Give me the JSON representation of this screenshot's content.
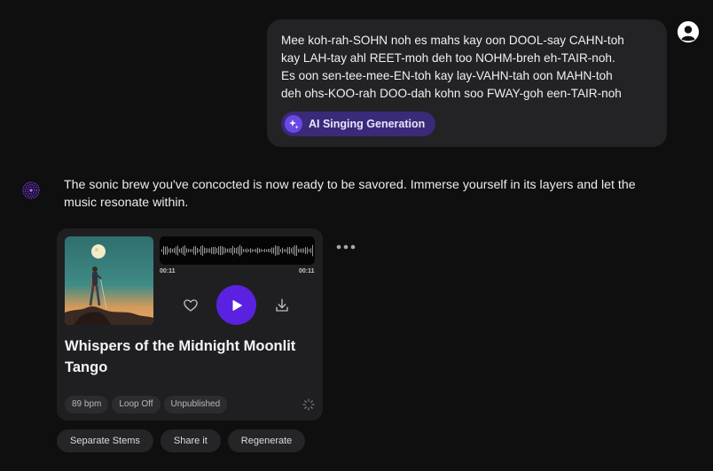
{
  "user_message": {
    "text": "Mee koh-rah-SOHN noh es mahs kay oon DOOL-say CAHN-toh\nkay LAH-tay ahl REET-moh deh too NOHM-breh eh-TAIR-noh.\nEs oon sen-tee-mee-EN-toh kay lay-VAHN-tah oon MAHN-toh\ndeh ohs-KOO-rah DOO-dah kohn soo FWAY-goh een-TAIR-noh",
    "chip_label": "AI Singing Generation",
    "chip_icon": "sparkle-icon"
  },
  "assistant_message": {
    "text": "The sonic brew you've concocted is now ready to be savored. Immerse yourself in its layers and let the music resonate within."
  },
  "song": {
    "title": "Whispers of the Midnight Moonlit Tango",
    "time_current": "00:11",
    "time_total": "00:11",
    "tags": [
      "89 bpm",
      "Loop Off",
      "Unpublished"
    ]
  },
  "actions": [
    "Separate Stems",
    "Share it",
    "Regenerate"
  ],
  "colors": {
    "accent": "#5a22e0",
    "chip_bg": "#3a2a78",
    "background": "#0f0f10",
    "card": "#1f1f21"
  }
}
